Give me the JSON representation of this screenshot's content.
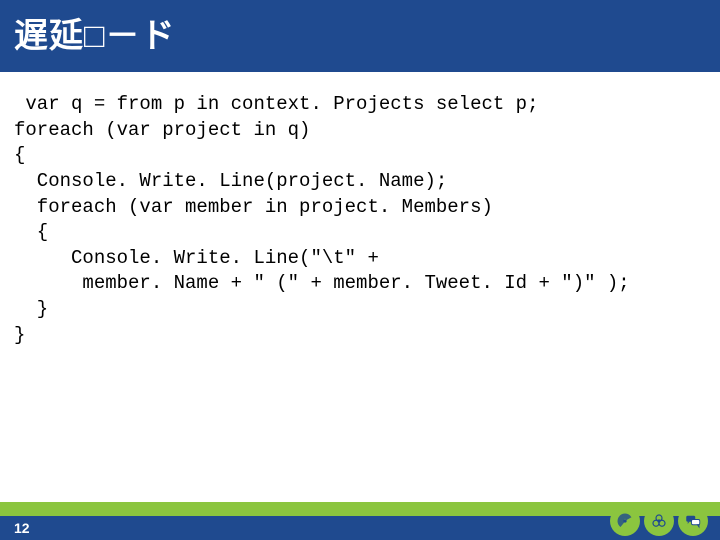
{
  "header": {
    "title": "遅延□－ド"
  },
  "code": {
    "lines": [
      " var q = from p in context. Projects select p;",
      "foreach (var project in q)",
      "{",
      "  Console. Write. Line(project. Name);",
      "  foreach (var member in project. Members)",
      "  {",
      "     Console. Write. Line(\"\\t\" +",
      "      member. Name + \" (\" + member. Tweet. Id + \")\" );",
      "  }",
      "}"
    ]
  },
  "footer": {
    "page_number": "12"
  }
}
